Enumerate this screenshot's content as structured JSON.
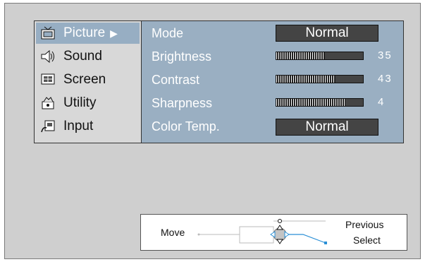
{
  "sidebar": {
    "items": [
      {
        "label": "Picture",
        "icon": "picture-icon",
        "active": true
      },
      {
        "label": "Sound",
        "icon": "sound-icon",
        "active": false
      },
      {
        "label": "Screen",
        "icon": "screen-icon",
        "active": false
      },
      {
        "label": "Utility",
        "icon": "utility-icon",
        "active": false
      },
      {
        "label": "Input",
        "icon": "input-icon",
        "active": false
      }
    ],
    "active_arrow": "▶"
  },
  "settings": {
    "mode": {
      "label": "Mode",
      "value": "Normal"
    },
    "brightness": {
      "label": "Brightness",
      "value": "35",
      "level": 0.56
    },
    "contrast": {
      "label": "Contrast",
      "value": "43",
      "level": 0.68
    },
    "sharpness": {
      "label": "Sharpness",
      "value": "4",
      "level": 0.8
    },
    "color_temp": {
      "label": "Color Temp.",
      "value": "Normal"
    }
  },
  "guide": {
    "move_label": "Move",
    "previous_label": "Previous",
    "select_label": "Select"
  },
  "colors": {
    "osd_background": "#9aafc2",
    "sidebar_background": "#d8d8d8",
    "value_box": "#444444",
    "guide_line": "#2a8fd6"
  }
}
